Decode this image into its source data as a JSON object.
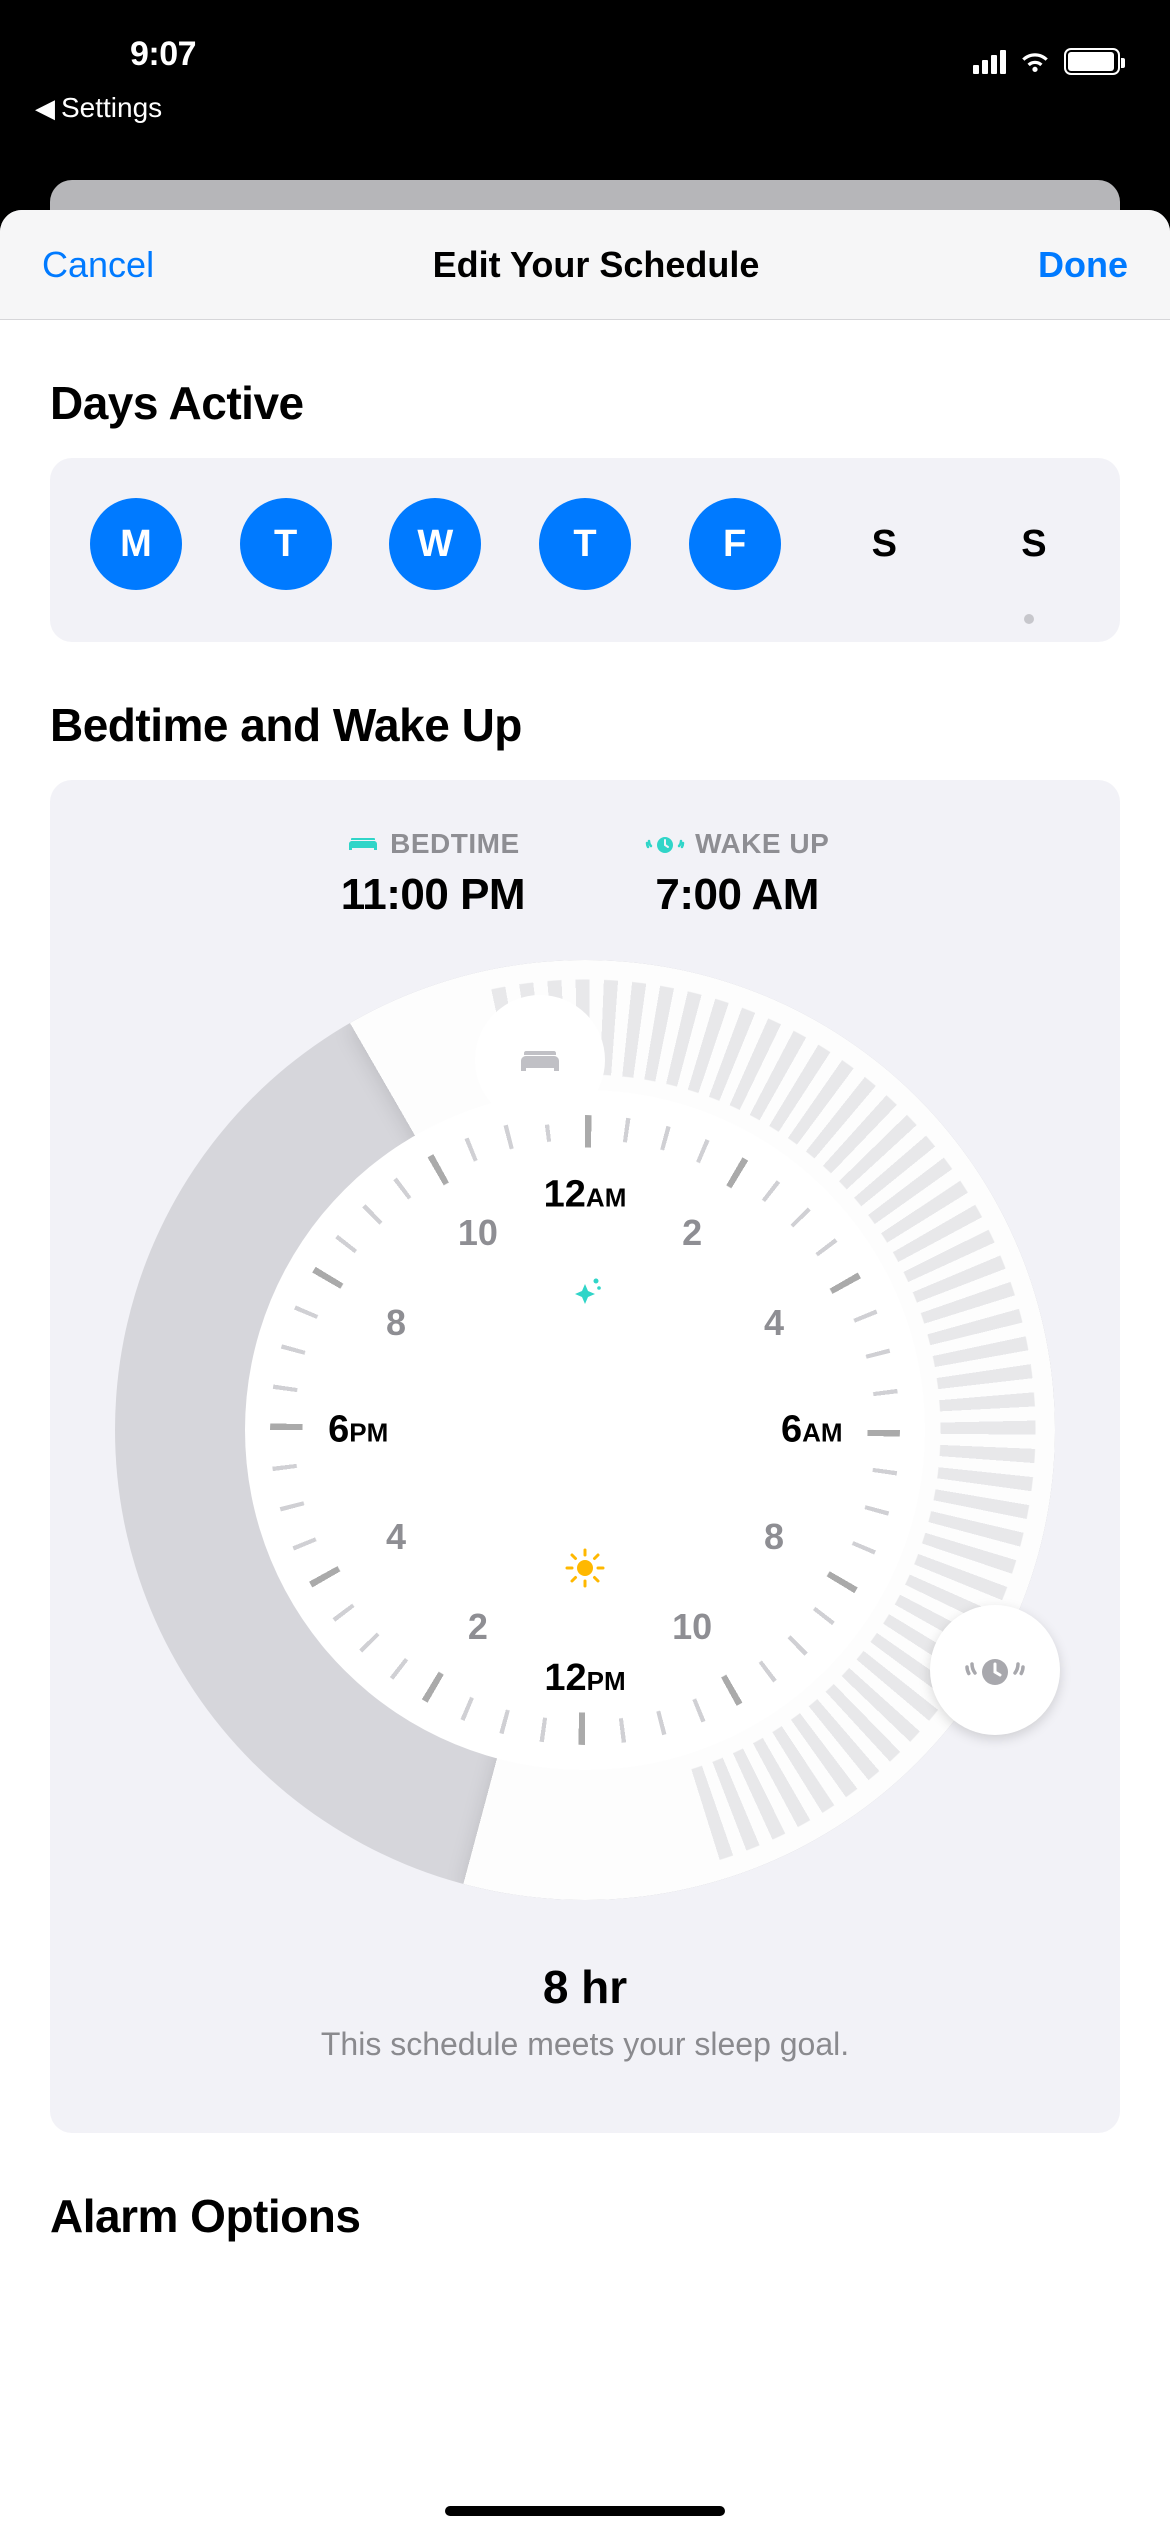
{
  "statusbar": {
    "time": "9:07",
    "breadcrumb": "Settings"
  },
  "nav": {
    "cancel": "Cancel",
    "title": "Edit Your Schedule",
    "done": "Done"
  },
  "sections": {
    "daysActive": {
      "title": "Days Active",
      "days": [
        {
          "label": "M",
          "active": true
        },
        {
          "label": "T",
          "active": true
        },
        {
          "label": "W",
          "active": true
        },
        {
          "label": "T",
          "active": true
        },
        {
          "label": "F",
          "active": true
        },
        {
          "label": "S",
          "active": false
        },
        {
          "label": "S",
          "active": false
        }
      ]
    },
    "sleep": {
      "title": "Bedtime and Wake Up",
      "bedtimeLabel": "BEDTIME",
      "wakeupLabel": "WAKE UP",
      "bedtimeValue": "11:00 PM",
      "wakeupValue": "7:00 AM",
      "clock": {
        "h12am": "12",
        "amTop": "AM",
        "h2t": "2",
        "h4t": "4",
        "h6am": "6",
        "amRight": "AM",
        "h8r": "8",
        "h10r": "10",
        "h12pm": "12",
        "pmBottom": "PM",
        "h2b": "2",
        "h4b": "4",
        "h6pm": "6",
        "pmLeft": "PM",
        "h8l": "8",
        "h10l": "10"
      },
      "summaryHr": "8 hr",
      "summarySub": "This schedule meets your sleep goal."
    },
    "alarmOptions": {
      "title": "Alarm Options"
    }
  }
}
